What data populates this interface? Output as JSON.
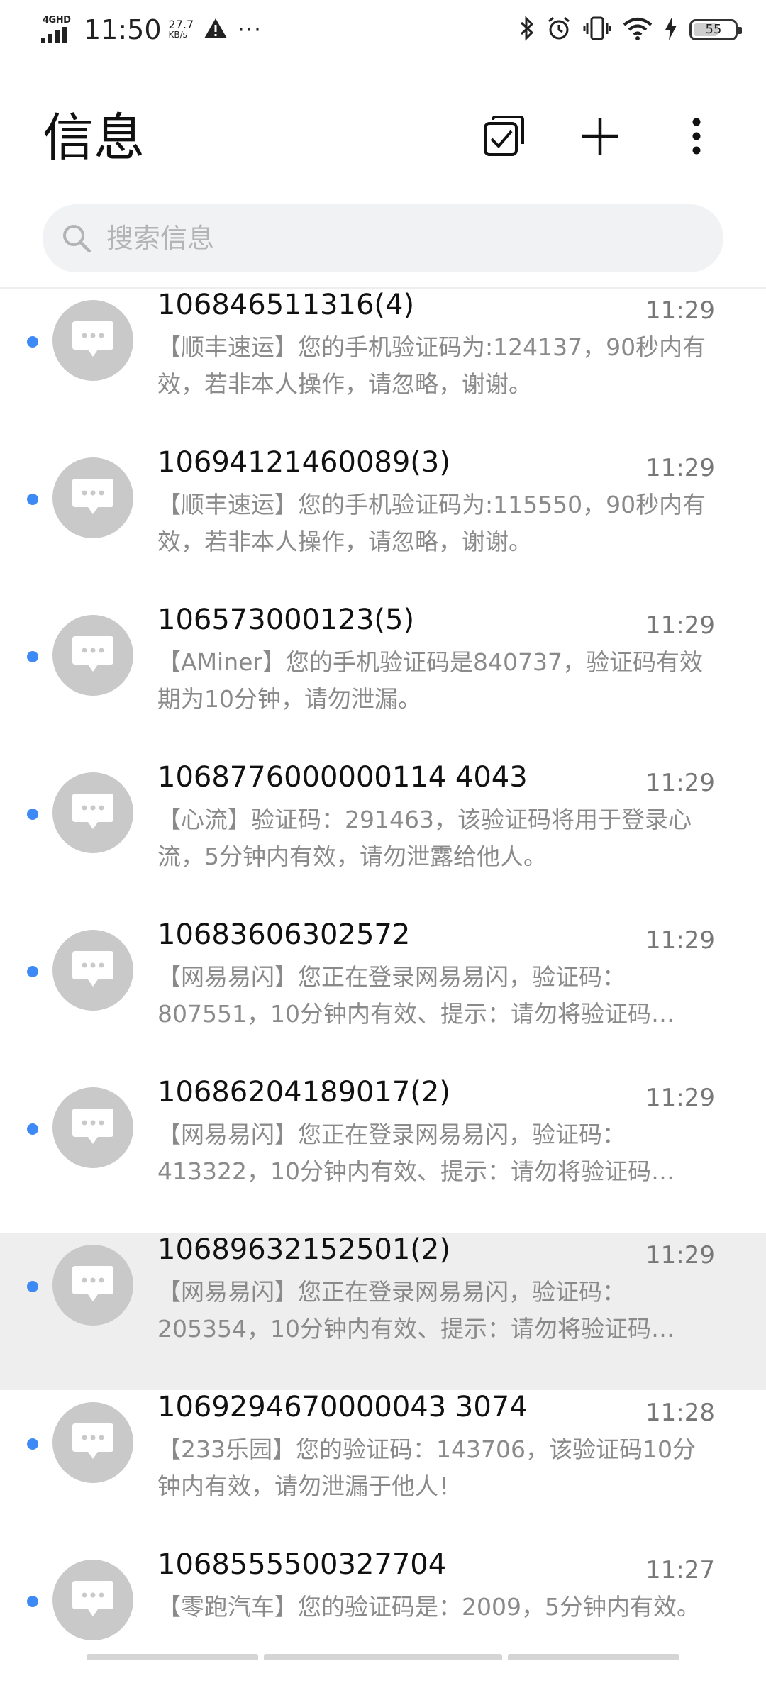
{
  "status_bar": {
    "network": "4GHD",
    "time": "11:50",
    "speed_value": "27.7",
    "speed_unit": "KB/s",
    "more": "···",
    "battery": "55",
    "icons": [
      "signal-icon",
      "warning-icon",
      "bluetooth-icon",
      "alarm-icon",
      "vibrate-icon",
      "wifi-icon",
      "charging-icon",
      "battery-icon"
    ]
  },
  "header": {
    "title": "信息",
    "actions": [
      "multi-select-icon",
      "add-icon",
      "more-vert-icon"
    ]
  },
  "search": {
    "placeholder": "搜索信息"
  },
  "conversations": [
    {
      "sender": "106846511316(4)",
      "time": "11:29",
      "preview": "【顺丰速运】您的手机验证码为:124137，90秒内有效，若非本人操作，请忽略，谢谢。",
      "unread": true
    },
    {
      "sender": "10694121460089(3)",
      "time": "11:29",
      "preview": "【顺丰速运】您的手机验证码为:115550，90秒内有效，若非本人操作，请忽略，谢谢。",
      "unread": true
    },
    {
      "sender": "106573000123(5)",
      "time": "11:29",
      "preview": "【AMiner】您的手机验证码是840737，验证码有效期为10分钟，请勿泄漏。",
      "unread": true
    },
    {
      "sender": "1068776000000114 4043",
      "time": "11:29",
      "preview": "【心流】验证码：291463，该验证码将用于登录心流，5分钟内有效，请勿泄露给他人。",
      "unread": true
    },
    {
      "sender": "10683606302572",
      "time": "11:29",
      "preview": "【网易易闪】您正在登录网易易闪，验证码：807551，10分钟内有效、提示：请勿将验证码…",
      "unread": true
    },
    {
      "sender": "10686204189017(2)",
      "time": "11:29",
      "preview": "【网易易闪】您正在登录网易易闪，验证码：413322，10分钟内有效、提示：请勿将验证码…",
      "unread": true
    },
    {
      "sender": "10689632152501(2)",
      "time": "11:29",
      "preview": "【网易易闪】您正在登录网易易闪，验证码：205354，10分钟内有效、提示：请勿将验证码…",
      "unread": true,
      "selected": true
    },
    {
      "sender": "1069294670000043 3074",
      "time": "11:28",
      "preview": "【233乐园】您的验证码：143706，该验证码10分钟内有效，请勿泄漏于他人！",
      "unread": true
    },
    {
      "sender": "1068555500327704",
      "time": "11:27",
      "preview": "【零跑汽车】您的验证码是：2009，5分钟内有效。",
      "unread": true
    }
  ]
}
